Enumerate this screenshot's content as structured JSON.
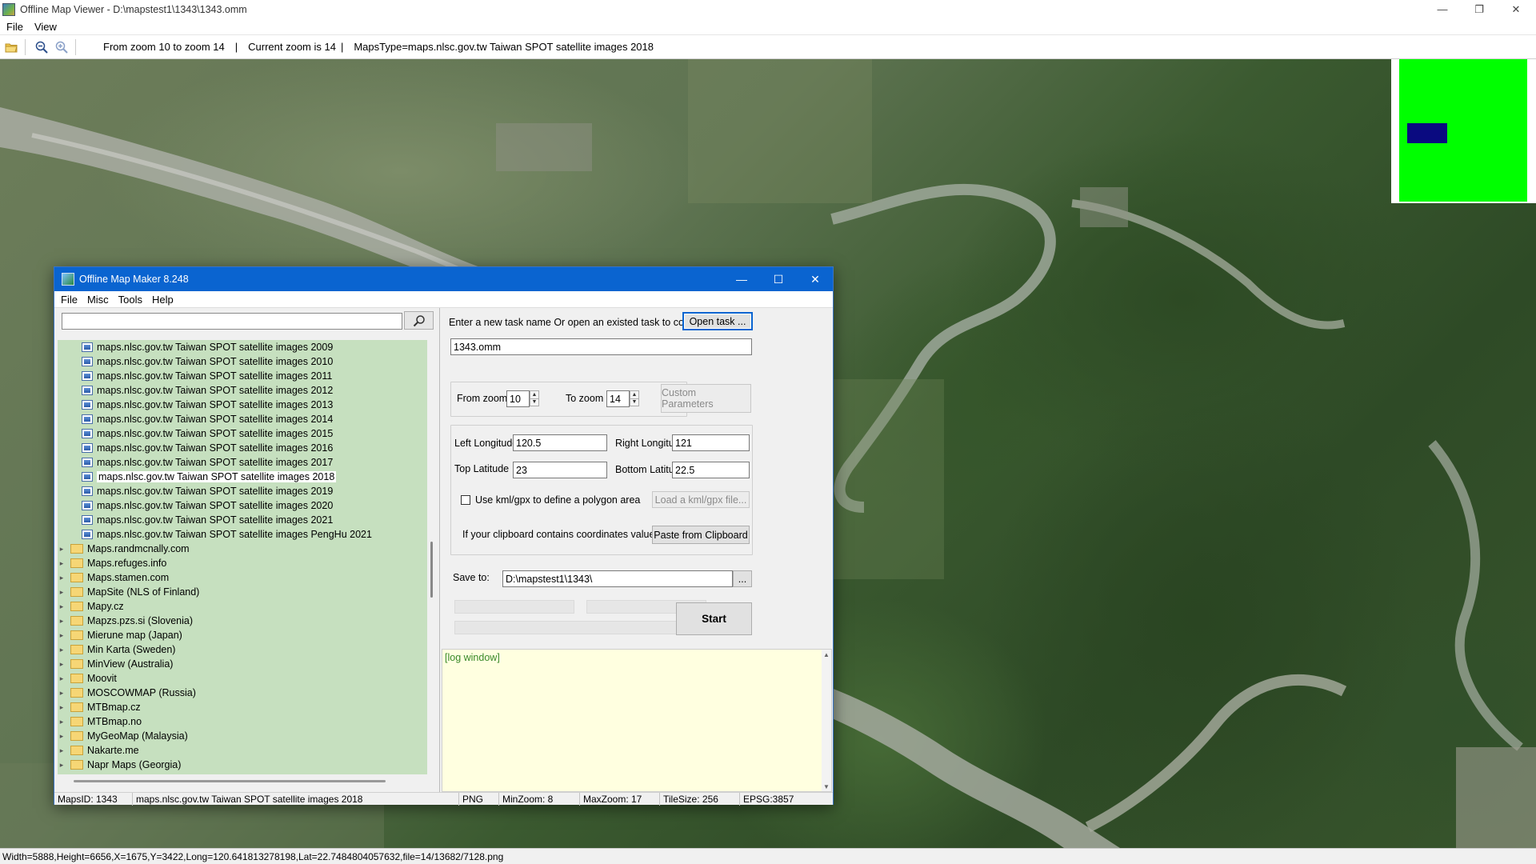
{
  "viewer": {
    "title": "Offline Map Viewer - D:\\mapstest1\\1343\\1343.omm",
    "menu": [
      "File",
      "View"
    ],
    "toolbar": {
      "zoom_range": "From zoom 10 to zoom 14",
      "current_zoom": "Current zoom is 14",
      "maps_type": "MapsType=maps.nlsc.gov.tw Taiwan SPOT satellite images 2018",
      "separator": "|"
    },
    "status": "Width=5888,Height=6656,X=1675,Y=3422,Long=120.641813278198,Lat=22.7484804057632,file=14/13682/7128.png",
    "window_controls": {
      "minimize": "—",
      "restore": "❐",
      "close": "✕"
    }
  },
  "dialog": {
    "title": "Offline Map Maker 8.248",
    "menu": [
      "File",
      "Misc",
      "Tools",
      "Help"
    ],
    "search": {
      "value": "",
      "icon": "search-icon"
    },
    "tree": {
      "leaves": [
        "maps.nlsc.gov.tw Taiwan SPOT satellite images 2009",
        "maps.nlsc.gov.tw Taiwan SPOT satellite images 2010",
        "maps.nlsc.gov.tw Taiwan SPOT satellite images 2011",
        "maps.nlsc.gov.tw Taiwan SPOT satellite images 2012",
        "maps.nlsc.gov.tw Taiwan SPOT satellite images 2013",
        "maps.nlsc.gov.tw Taiwan SPOT satellite images 2014",
        "maps.nlsc.gov.tw Taiwan SPOT satellite images 2015",
        "maps.nlsc.gov.tw Taiwan SPOT satellite images 2016",
        "maps.nlsc.gov.tw Taiwan SPOT satellite images 2017",
        "maps.nlsc.gov.tw Taiwan SPOT satellite images 2018",
        "maps.nlsc.gov.tw Taiwan SPOT satellite images 2019",
        "maps.nlsc.gov.tw Taiwan SPOT satellite images 2020",
        "maps.nlsc.gov.tw Taiwan SPOT satellite images 2021",
        "maps.nlsc.gov.tw Taiwan SPOT satellite images PengHu 2021"
      ],
      "selected_leaf": "maps.nlsc.gov.tw Taiwan SPOT satellite images 2018",
      "folders": [
        "Maps.randmcnally.com",
        "Maps.refuges.info",
        "Maps.stamen.com",
        "MapSite (NLS of Finland)",
        "Mapy.cz",
        "Mapzs.pzs.si (Slovenia)",
        "Mierune map (Japan)",
        "Min Karta (Sweden)",
        "MinView (Australia)",
        "Moovit",
        "MOSCOWMAP (Russia)",
        "MTBmap.cz",
        "MTBmap.no",
        "MyGeoMap (Malaysia)",
        "Nakarte.me",
        "Napr Maps (Georgia)"
      ]
    },
    "task": {
      "prompt": "Enter a new task name Or open an existed task to continue:",
      "open_task_label": "Open task ...",
      "task_name": "1343.omm"
    },
    "zoom": {
      "from_label": "From zoom",
      "from_value": "10",
      "to_label": "To zoom",
      "to_value": "14",
      "custom_params_label": "Custom Parameters"
    },
    "bounds": {
      "left_lon_label": "Left Longitude",
      "left_lon_value": "120.5",
      "right_lon_label": "Right Longitude",
      "right_lon_value": "121",
      "top_lat_label": "Top Latitude",
      "top_lat_value": "23",
      "bottom_lat_label": "Bottom Latitude",
      "bottom_lat_value": "22.5",
      "kml_checkbox_label": "Use kml/gpx to define a polygon area",
      "kml_checked": false,
      "load_kml_label": "Load a kml/gpx file...",
      "clipboard_prompt": "If your clipboard contains coordinates values:",
      "paste_label": "Paste from Clipboard"
    },
    "save": {
      "label": "Save to:",
      "path": "D:\\mapstest1\\1343\\",
      "browse_label": "..."
    },
    "start_label": "Start",
    "log_text": "[log window]",
    "status": {
      "maps_id": "MapsID: 1343",
      "maps_name": "maps.nlsc.gov.tw Taiwan SPOT satellite images 2018",
      "format": "PNG",
      "min_zoom": "MinZoom: 8",
      "max_zoom": "MaxZoom: 17",
      "tile_size": "TileSize: 256",
      "epsg": "EPSG:3857"
    },
    "window_controls": {
      "minimize": "—",
      "maximize": "☐",
      "close": "✕"
    }
  },
  "colors": {
    "dialog_title": "#0a64d0",
    "tree_bg": "#c6e0bf",
    "log_bg": "#ffffe0",
    "log_text": "#3a8a2a",
    "minimap_green": "#00ff00",
    "minimap_viewport": "#0a0a80"
  }
}
